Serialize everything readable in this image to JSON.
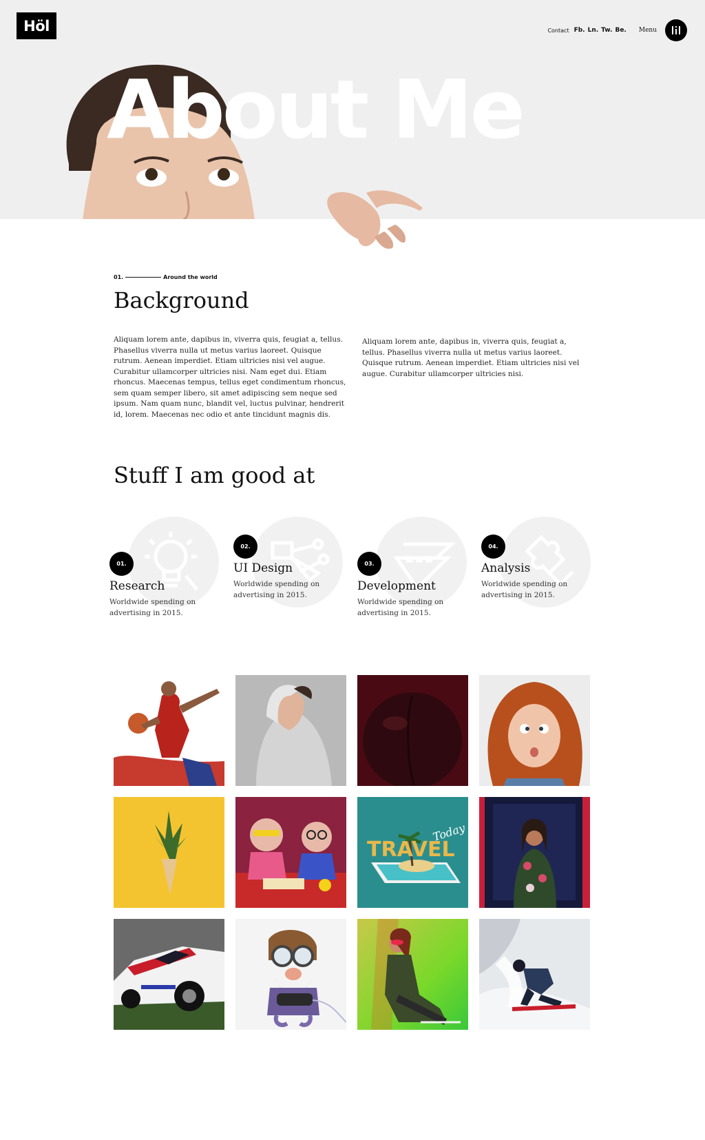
{
  "header": {
    "logo_text": "Höl",
    "nav": {
      "contact": "Contact",
      "social": [
        "Fb.",
        "Ln.",
        "Tw.",
        "Be."
      ],
      "menu_label": "Menu"
    }
  },
  "hero": {
    "title": "About Me"
  },
  "background": {
    "eyebrow_number": "01.",
    "eyebrow_text": "Around the world",
    "title": "Background",
    "paragraph_left": "Aliquam lorem ante, dapibus in, viverra quis, feugiat a, tellus. Phasellus viverra nulla ut metus varius laoreet. Quisque rutrum. Aenean imperdiet. Etiam ultricies nisi vel augue. Curabitur ullamcorper ultricies nisi. Nam eget dui. Etiam rhoncus. Maecenas tempus, tellus eget condimentum rhoncus, sem quam semper libero, sit amet adipiscing sem neque sed ipsum. Nam quam nunc, blandit vel, luctus pulvinar, hendrerit id, lorem. Maecenas nec odio et ante tincidunt magnis dis.",
    "paragraph_right": "Aliquam lorem ante, dapibus in, viverra quis, feugiat a, tellus. Phasellus viverra nulla ut metus varius laoreet. Quisque rutrum. Aenean imperdiet. Etiam ultricies nisi vel augue. Curabitur ullamcorper ultricies nisi."
  },
  "skills": {
    "title": "Stuff I am good at",
    "items": [
      {
        "number": "01.",
        "title": "Research",
        "description": "Worldwide spending on advertising in 2015.",
        "icon": "lightbulb-icon"
      },
      {
        "number": "02.",
        "title": "UI Design",
        "description": "Worldwide spending on advertising in 2015.",
        "icon": "vector-pen-icon"
      },
      {
        "number": "03.",
        "title": "Development",
        "description": "Worldwide spending on advertising in 2015.",
        "icon": "ruler-triangle-icon"
      },
      {
        "number": "04.",
        "title": "Analysis",
        "description": "Worldwide spending on advertising in 2015.",
        "icon": "puzzle-icon"
      }
    ]
  },
  "gallery": {
    "tiles": [
      {
        "name": "basketball-player-image"
      },
      {
        "name": "woman-hoodie-image"
      },
      {
        "name": "dark-fruit-image"
      },
      {
        "name": "curly-hair-girl-image"
      },
      {
        "name": "pineapple-cone-image"
      },
      {
        "name": "kids-science-image"
      },
      {
        "name": "travel-phone-image",
        "text_1": "TRAVEL",
        "text_2": "Today"
      },
      {
        "name": "woman-speaker-image"
      },
      {
        "name": "race-car-image"
      },
      {
        "name": "cartoon-pilot-image"
      },
      {
        "name": "neon-woman-image"
      },
      {
        "name": "snowboarder-image"
      }
    ]
  },
  "colors": {
    "hero_bg": "#efefef",
    "ink": "#111111",
    "skill_circle": "#f1f1f1"
  }
}
